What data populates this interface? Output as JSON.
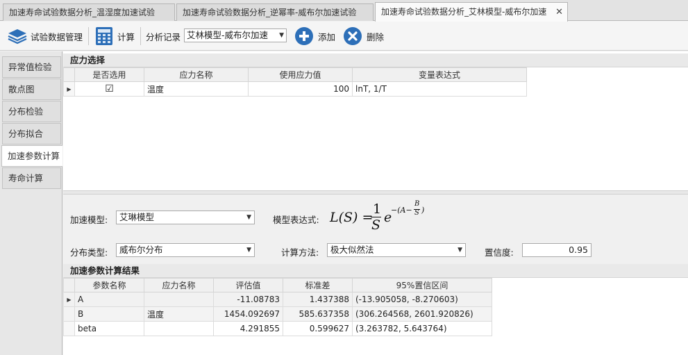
{
  "tabs": [
    {
      "label": "加速寿命试验数据分析_温湿度加速试验"
    },
    {
      "label": "加速寿命试验数据分析_逆幂率-威布尔加速试验"
    },
    {
      "label": "加速寿命试验数据分析_艾林模型-威布尔加速",
      "close": "✕"
    }
  ],
  "toolbar": {
    "data_mgmt": "试验数据管理",
    "calc": "计算",
    "record_label": "分析记录",
    "record_value": "艾林模型-威布尔加速",
    "add": "添加",
    "delete": "删除"
  },
  "leftnav": {
    "items": [
      {
        "label": "异常值检验"
      },
      {
        "label": "散点图"
      },
      {
        "label": "分布检验"
      },
      {
        "label": "分布拟合"
      },
      {
        "label": "加速参数计算"
      },
      {
        "label": "寿命计算"
      }
    ]
  },
  "stress": {
    "title": "应力选择",
    "headers": [
      "是否选用",
      "应力名称",
      "使用应力值",
      "变量表达式"
    ],
    "rows": [
      {
        "selected": "☑",
        "name": "温度",
        "value": "100",
        "expr": "lnT, 1/T"
      }
    ]
  },
  "params": {
    "model_label": "加速模型:",
    "model_value": "艾琳模型",
    "formula_label": "模型表达式:",
    "formula": {
      "lhs": "L(S) =",
      "num": "1",
      "den": "S",
      "base": "e",
      "exp_pre": "−(A−",
      "exp_num": "B",
      "exp_den": "S",
      "exp_post": ")"
    },
    "dist_label": "分布类型:",
    "dist_value": "威布尔分布",
    "method_label": "计算方法:",
    "method_value": "极大似然法",
    "conf_label": "置信度:",
    "conf_value": "0.95"
  },
  "results": {
    "title": "加速参数计算结果",
    "headers": [
      "参数名称",
      "应力名称",
      "评估值",
      "标准差",
      "95%置信区间"
    ],
    "rows": [
      {
        "param": "A",
        "stress": "",
        "est": "-11.08783",
        "std": "1.437388",
        "ci": "(-13.905058, -8.270603)"
      },
      {
        "param": "B",
        "stress": "温度",
        "est": "1454.092697",
        "std": "585.637358",
        "ci": "(306.264568, 2601.920826)"
      },
      {
        "param": "beta",
        "stress": "",
        "est": "4.291855",
        "std": "0.599627",
        "ci": "(3.263782, 5.643764)"
      }
    ]
  },
  "colors": {
    "accent_blue": "#1f6fbf",
    "icon_blue": "#2d7dd2"
  }
}
